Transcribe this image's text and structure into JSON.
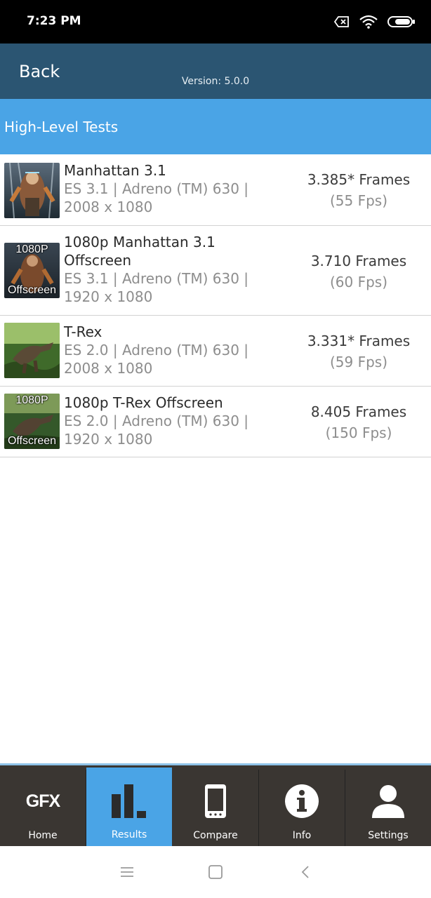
{
  "status_bar": {
    "time": "7:23 PM",
    "icons": [
      "no-sim-icon",
      "wifi-icon",
      "battery-icon"
    ]
  },
  "header": {
    "back_label": "Back",
    "version": "Version: 5.0.0"
  },
  "section": {
    "title": "High-Level Tests"
  },
  "results": [
    {
      "title": "Manhattan 3.1",
      "subtitle_line1": "ES 3.1 | Adreno (TM) 630 |",
      "subtitle_line2": "2008 x 1080",
      "score": "3.385* Frames",
      "fps": "(55 Fps)",
      "thumb_overlay_top": "",
      "thumb_overlay_bottom": ""
    },
    {
      "title_line1": "1080p Manhattan 3.1",
      "title_line2": "Offscreen",
      "subtitle_line1": "ES 3.1 | Adreno (TM) 630 |",
      "subtitle_line2": "1920 x 1080",
      "score": "3.710 Frames",
      "fps": "(60 Fps)",
      "thumb_overlay_top": "1080P",
      "thumb_overlay_bottom": "Offscreen"
    },
    {
      "title": "T-Rex",
      "subtitle_line1": "ES 2.0 | Adreno (TM) 630 |",
      "subtitle_line2": "2008 x 1080",
      "score": "3.331* Frames",
      "fps": "(59 Fps)",
      "thumb_overlay_top": "",
      "thumb_overlay_bottom": ""
    },
    {
      "title": "1080p T-Rex Offscreen",
      "subtitle_line1": "ES 2.0 | Adreno (TM) 630 |",
      "subtitle_line2": "1920 x 1080",
      "score": "8.405 Frames",
      "fps": "(150 Fps)",
      "thumb_overlay_top": "1080P",
      "thumb_overlay_bottom": "Offscreen"
    }
  ],
  "tabs": [
    {
      "label": "Home",
      "icon": "gfx-logo-icon",
      "active": false,
      "logo_text": "GFX"
    },
    {
      "label": "Results",
      "icon": "bar-chart-icon",
      "active": true
    },
    {
      "label": "Compare",
      "icon": "phone-icon",
      "active": false
    },
    {
      "label": "Info",
      "icon": "info-icon",
      "active": false
    },
    {
      "label": "Settings",
      "icon": "user-icon",
      "active": false
    }
  ],
  "nav_bar": {
    "buttons": [
      "menu-icon",
      "home-square-icon",
      "back-chevron-icon"
    ]
  },
  "colors": {
    "header_bg": "#2b5572",
    "section_bg": "#4aa4e6",
    "tab_bar_bg": "#3a3632",
    "tab_active_bg": "#4aa4e6"
  }
}
